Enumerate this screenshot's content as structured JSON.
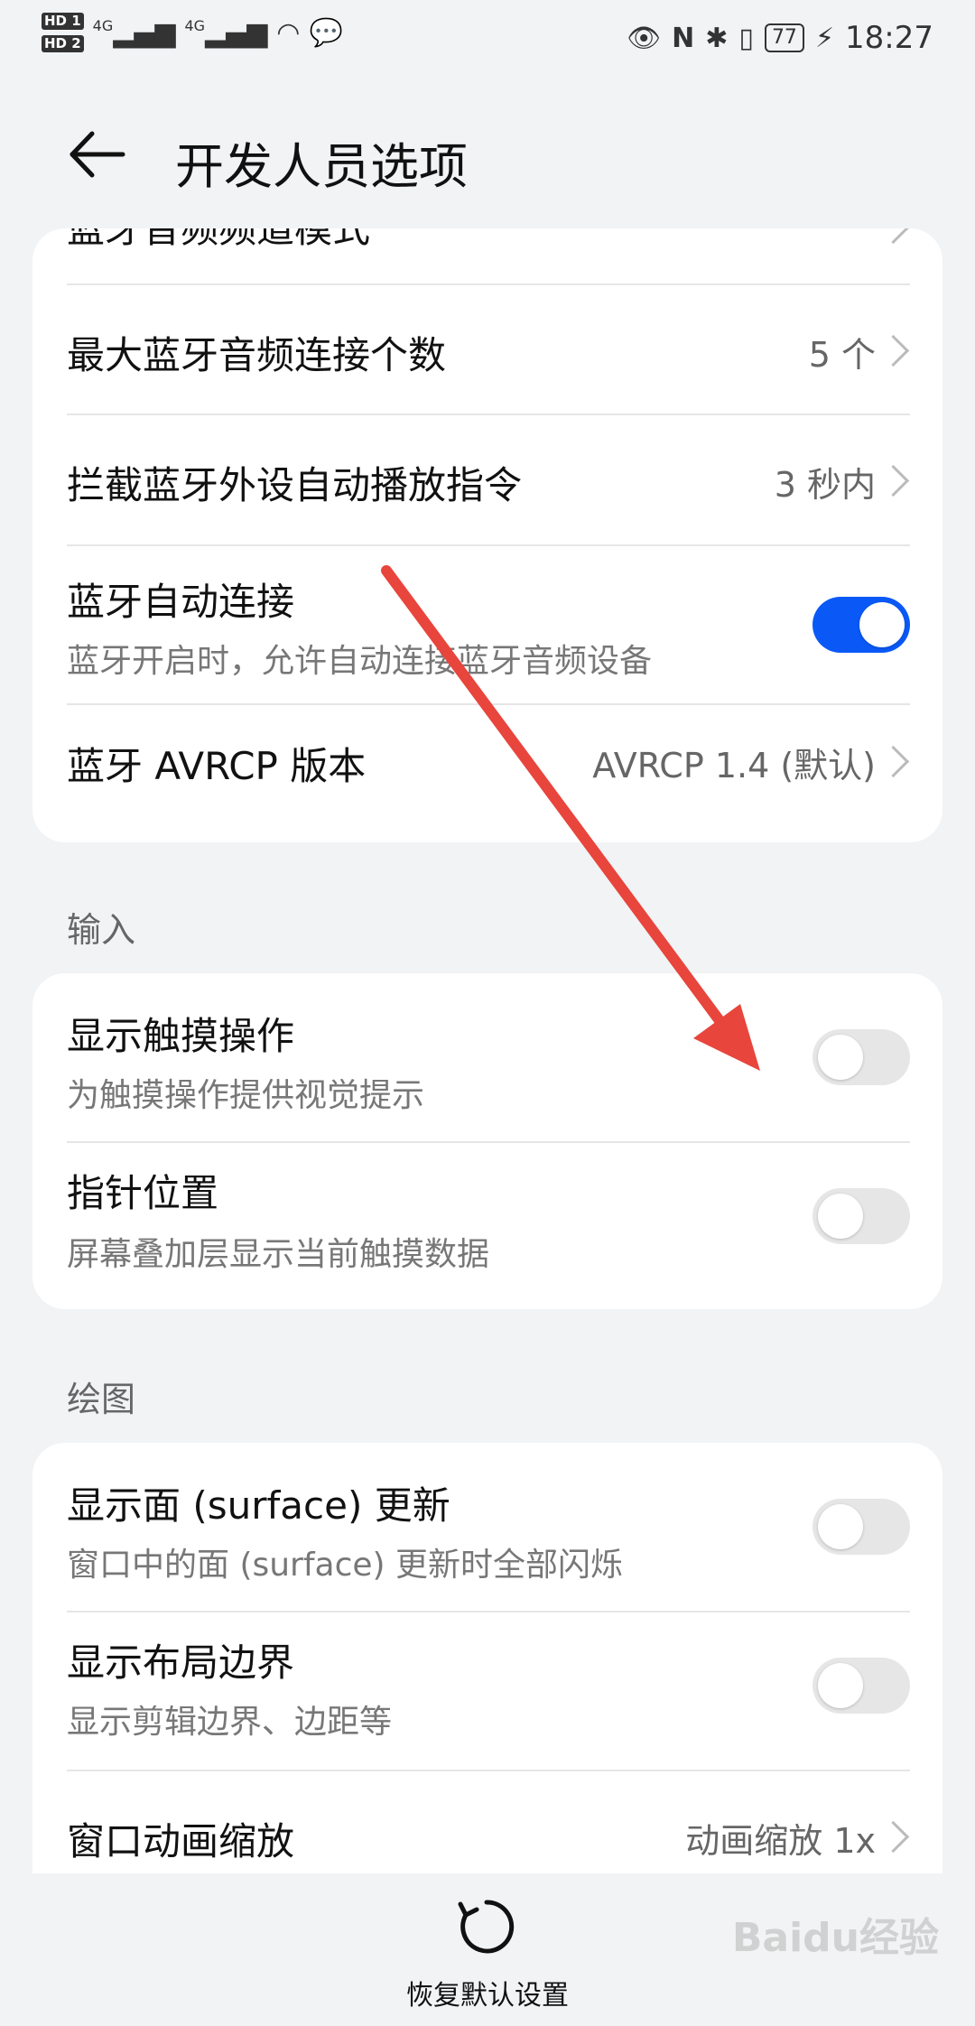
{
  "status_bar": {
    "sim1": "HD 1",
    "sim2": "HD 2",
    "signal1": "4G",
    "signal2": "4G",
    "battery": "77",
    "time": "18:27"
  },
  "header": {
    "title": "开发人员选项"
  },
  "top_card": {
    "partial_item": "蓝牙音频频道模式",
    "items": [
      {
        "title": "最大蓝牙音频连接个数",
        "value": "5 个"
      },
      {
        "title": "拦截蓝牙外设自动播放指令",
        "value": "3 秒内"
      },
      {
        "title": "蓝牙自动连接",
        "subtitle": "蓝牙开启时，允许自动连接蓝牙音频设备",
        "toggle": "on"
      },
      {
        "title": "蓝牙 AVRCP 版本",
        "value": "AVRCP 1.4 (默认)"
      }
    ]
  },
  "input_section": {
    "label": "输入",
    "items": [
      {
        "title": "显示触摸操作",
        "subtitle": "为触摸操作提供视觉提示",
        "toggle": "off"
      },
      {
        "title": "指针位置",
        "subtitle": "屏幕叠加层显示当前触摸数据",
        "toggle": "off"
      }
    ]
  },
  "drawing_section": {
    "label": "绘图",
    "items": [
      {
        "title": "显示面 (surface) 更新",
        "subtitle": "窗口中的面 (surface) 更新时全部闪烁",
        "toggle": "off"
      },
      {
        "title": "显示布局边界",
        "subtitle": "显示剪辑边界、边距等",
        "toggle": "off"
      },
      {
        "title": "窗口动画缩放",
        "value": "动画缩放 1x"
      }
    ]
  },
  "bottom": {
    "reset_label": "恢复默认设置"
  },
  "watermark": "Baidu经验",
  "colors": {
    "accent": "#0a59f7",
    "arrow": "#e8453c"
  }
}
